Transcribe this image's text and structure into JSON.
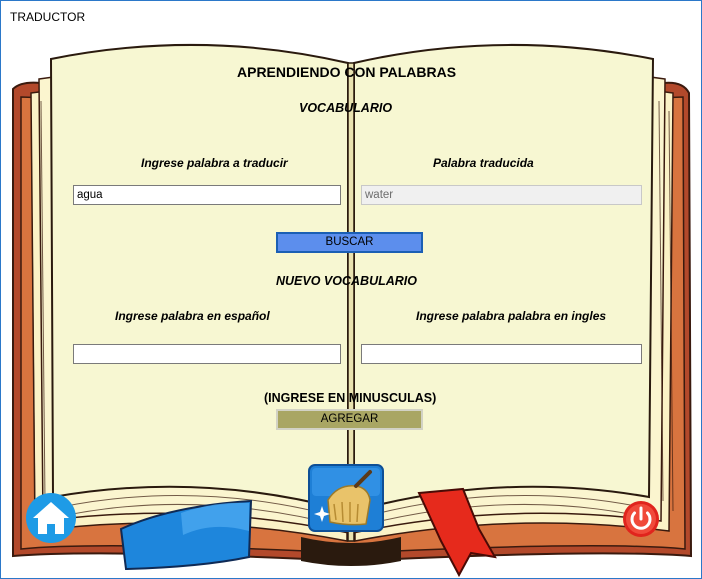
{
  "window": {
    "title": "TRADUCTOR"
  },
  "header": {
    "title": "APRENDIENDO CON PALABRAS",
    "section1": "VOCABULARIO"
  },
  "translate": {
    "source_label": "Ingrese palabra a traducir",
    "source_value": "agua",
    "result_label": "Palabra traducida",
    "result_value": "water",
    "search_button": "BUSCAR"
  },
  "new_vocab": {
    "title": "NUEVO VOCABULARIO",
    "spanish_label": "Ingrese palabra en español",
    "spanish_value": "",
    "english_label": "Ingrese palabra palabra en ingles",
    "english_value": "",
    "note": "(INGRESE EN MINUSCULAS)",
    "add_button": "AGREGAR"
  },
  "icons": {
    "home": "home-icon",
    "clean": "broom-icon",
    "power": "power-icon"
  },
  "colors": {
    "page": "#f7f7d2",
    "cover": "#b3492b",
    "buscar": "#5c8eed",
    "agregar": "#a9a663",
    "home": "#1e9be6",
    "power": "#e0241d"
  }
}
